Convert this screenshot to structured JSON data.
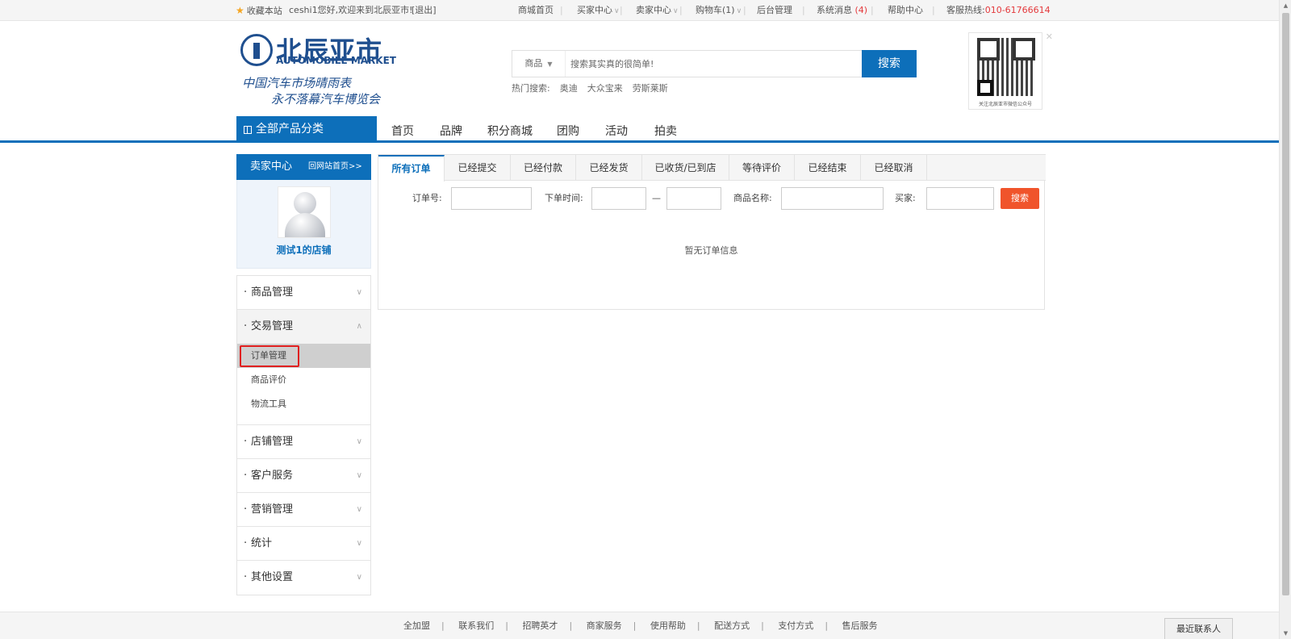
{
  "topbar": {
    "favorite": "收藏本站",
    "greeting": "ceshi1您好,欢迎来到北辰亚市!",
    "logout": "[退出]",
    "links": [
      "商城首页",
      "买家中心",
      "卖家中心",
      "购物车(1)",
      "后台管理",
      "系统消息"
    ],
    "msg_count": "(4)",
    "help": "帮助中心",
    "hotline_label": "客服热线:",
    "hotline": "010-61766614"
  },
  "logo": {
    "cn": "北辰亚市",
    "en": "AUTOMOBILE MARKET",
    "slogan1": "中国汽车市场晴雨表",
    "slogan2": "永不落幕汽车博览会"
  },
  "search": {
    "category": "商品",
    "placeholder": "搜索其实真的很简单!",
    "button": "搜索",
    "hot_label": "热门搜索:",
    "hot": [
      "奥迪",
      "大众宝来",
      "劳斯莱斯"
    ]
  },
  "qr": {
    "caption": "关注北辰亚市微信公众号"
  },
  "nav": {
    "all_categories": "全部产品分类",
    "items": [
      "首页",
      "品牌",
      "积分商城",
      "团购",
      "活动",
      "拍卖"
    ]
  },
  "sidebar": {
    "title": "卖家中心",
    "back": "回网站首页>>",
    "shop_name": "测试1的店铺",
    "groups": [
      {
        "label": "商品管理"
      },
      {
        "label": "交易管理",
        "children": [
          "订单管理",
          "商品评价",
          "物流工具"
        ]
      },
      {
        "label": "店铺管理"
      },
      {
        "label": "客户服务"
      },
      {
        "label": "营销管理"
      },
      {
        "label": "统计"
      },
      {
        "label": "其他设置"
      }
    ]
  },
  "main": {
    "tabs": [
      "所有订单",
      "已经提交",
      "已经付款",
      "已经发货",
      "已收货/已到店",
      "等待评价",
      "已经结束",
      "已经取消"
    ],
    "filters": {
      "order_no": "订单号:",
      "order_time": "下单时间:",
      "dash": "—",
      "product_name": "商品名称:",
      "buyer": "买家:",
      "button": "搜索"
    },
    "empty": "暂无订单信息"
  },
  "footer": {
    "links": [
      "全加盟",
      "联系我们",
      "招聘英才",
      "商家服务",
      "使用帮助",
      "配送方式",
      "支付方式",
      "售后服务"
    ],
    "recent_contacts": "最近联系人"
  }
}
